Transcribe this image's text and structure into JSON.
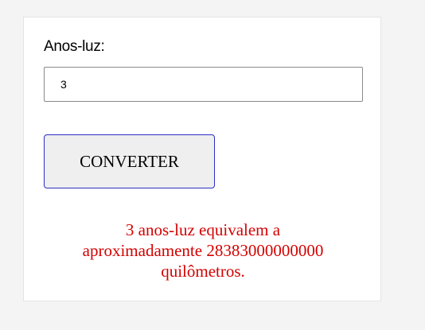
{
  "form": {
    "label": "Anos-luz:",
    "input_value": "3",
    "button_label": "CONVERTER"
  },
  "result": {
    "line1": "3 anos-luz equivalem a",
    "line2": "aproximadamente 28383000000000",
    "line3": "quilômetros.",
    "color": "#d40000"
  }
}
